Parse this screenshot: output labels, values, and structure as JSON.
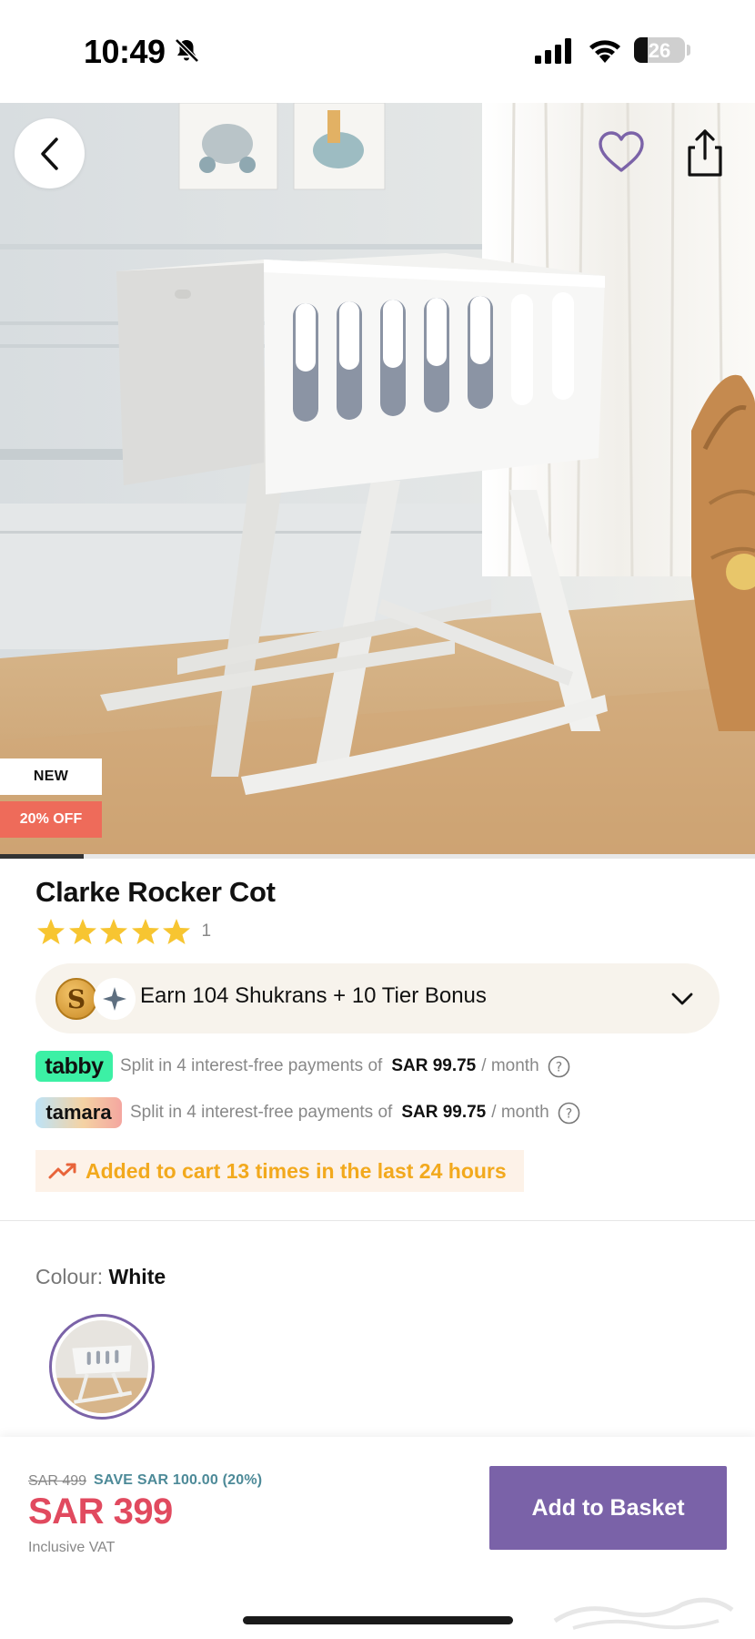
{
  "status_bar": {
    "time": "10:49",
    "battery_level": "26",
    "battery_fraction": 0.26,
    "icons": [
      "bell-slash-icon",
      "cellular-signal-icon",
      "wifi-icon",
      "battery-icon"
    ]
  },
  "hero": {
    "image": "product-photo-white-rocker-cot",
    "badges": {
      "new": "NEW",
      "discount": "20% OFF"
    },
    "carousel_position": {
      "current": 1
    },
    "icons": [
      "chevron-left-icon",
      "heart-icon",
      "share-icon"
    ]
  },
  "product": {
    "title": "Clarke Rocker Cot",
    "rating": {
      "stars": 5,
      "max": 5,
      "count": "1"
    }
  },
  "shukran": {
    "text": "Earn 104 Shukrans + 10 Tier Bonus",
    "coin_letter": "S"
  },
  "bnpl": [
    {
      "provider": "tabby",
      "text": "Split in 4 interest-free payments of",
      "amount": "SAR 99.75",
      "suffix": "/ month"
    },
    {
      "provider": "tamara",
      "text": "Split in 4 interest-free payments of",
      "amount": "SAR 99.75",
      "suffix": "/ month"
    }
  ],
  "trend": {
    "text": "Added to cart 13 times in the last 24 hours"
  },
  "colour": {
    "label": "Colour:",
    "value": "White"
  },
  "bottom_bar": {
    "old_price": "SAR 499",
    "savings": "SAVE SAR 100.00 (20%)",
    "price": "SAR 399",
    "vat": "Inclusive VAT",
    "button": "Add to Basket"
  },
  "colors": {
    "accent_purple": "#7a62a8",
    "price_red": "#e14a5f",
    "discount_badge": "#ee6b5a",
    "star_yellow": "#f7c531",
    "trend_orange": "#f2a91d",
    "tabby_green": "#3cf0a5"
  }
}
